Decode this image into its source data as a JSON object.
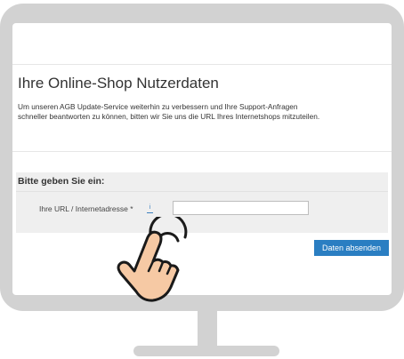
{
  "page": {
    "title": "Ihre Online-Shop Nutzerdaten",
    "intro_line1": "Um unseren AGB Update-Service weiterhin zu verbessern und Ihre Support-Anfragen",
    "intro_line2": "schneller beantworten zu können, bitten wir Sie uns die URL Ihres Internetshops mitzuteilen."
  },
  "form": {
    "heading": "Bitte geben Sie ein:",
    "url_label": "Ihre URL / Internetadresse *",
    "info_icon_glyph": "i",
    "url_value": "",
    "submit_label": "Daten absenden"
  },
  "icons": {
    "info": "info-icon",
    "pointer": "pointing-hand-icon"
  },
  "colors": {
    "accent": "#2a7ec2",
    "monitor": "#d2d2d2",
    "form_background": "#efefef"
  }
}
